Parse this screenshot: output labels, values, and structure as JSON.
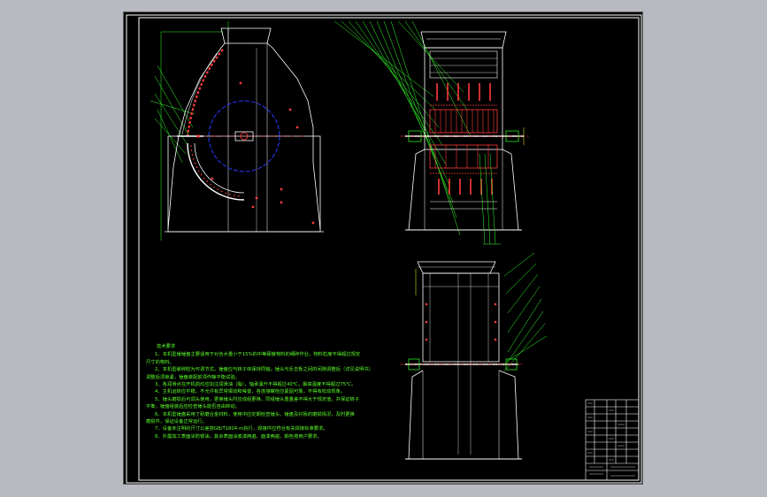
{
  "viewer": {
    "background_color": "#b7bac1",
    "canvas_color": "#000000",
    "frame_color": "#ffffff"
  },
  "drawing": {
    "line_colors": {
      "outline": "#ffffff",
      "centerline": "#ff3b3b",
      "leader": "#35ff2a",
      "rotor_circle": "#2a3bff",
      "dimension": "#ffff33",
      "hidden": "#00ffff"
    }
  },
  "notes": {
    "title": "技术要求",
    "lines": [
      "1、本机型锤锤盘主要适用于对含水量小于15%的中等硬度物料的细碎作业，物料粒度不得超过规定",
      "尺寸的物料。",
      "2、本机型破碎腔为可调节式，锤盘应与转子体保持同轴，锤头与反击板之间的间隙调整后（详见说明书）",
      "调整后须锁紧，锤盘装配前须作静平衡试验。",
      "3、各润滑点在开机前均应加注润滑油（脂），轴承温升不得超过40℃，最高温度不得超过75℃。",
      "4、主机运转应平稳，不允许有异常振动和噪音，各连接螺栓应紧固可靠，不得有松动现象。",
      "5、锤头磨损后可调头使用，更换锤头时应成组更换，同组锤头重量差不得大于规定值，并保证转子",
      "平衡，锤盘组装后应检查锤头能否自由转动。",
      "6、本机型锤盘采用了耐磨合金材料，使用中应定期检查锤头、锤盘及衬板的磨损情况，及时更换",
      "磨损件，保证设备正常运行。",
      "7、设备未注明的尺寸公差按GB/T1804-m执行，焊接件应符合有关焊接标准要求。",
      "8、外露加工表面涂防锈油，其余表面涂底漆两遍、面漆两遍，颜色按用户要求。"
    ]
  }
}
